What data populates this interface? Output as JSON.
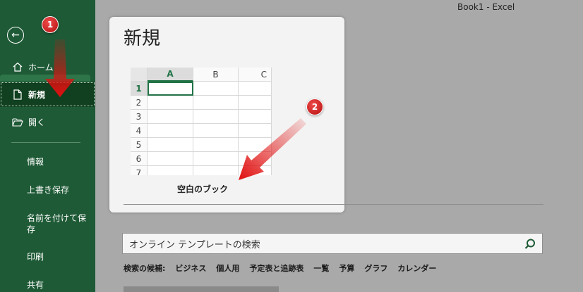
{
  "window": {
    "title": "Book1  -  Excel"
  },
  "sidebar": {
    "back_icon": "back-arrow-icon",
    "items": [
      {
        "label": "ホーム",
        "icon": "home-icon"
      },
      {
        "label": "新規",
        "icon": "new-document-icon"
      },
      {
        "label": "開く",
        "icon": "folder-open-icon"
      }
    ],
    "plain_items": [
      "情報",
      "上書き保存",
      "名前を付けて保存",
      "印刷",
      "共有"
    ],
    "accent_color": "#1e5a36",
    "selected_color": "#10401f"
  },
  "new_panel": {
    "title": "新規",
    "template_label": "空白のブック",
    "columns": [
      "A",
      "B",
      "C"
    ],
    "rows": [
      "1",
      "2",
      "3",
      "4",
      "5",
      "6",
      "7"
    ]
  },
  "search": {
    "placeholder": "オンライン テンプレートの検索",
    "icon": "search-icon"
  },
  "suggestions": {
    "label": "検索の候補:",
    "items": [
      "ビジネス",
      "個人用",
      "予定表と追跡表",
      "一覧",
      "予算",
      "グラフ",
      "カレンダー"
    ]
  },
  "annotations": {
    "step1": "1",
    "step2": "2",
    "arrow_color": "#e01010"
  }
}
